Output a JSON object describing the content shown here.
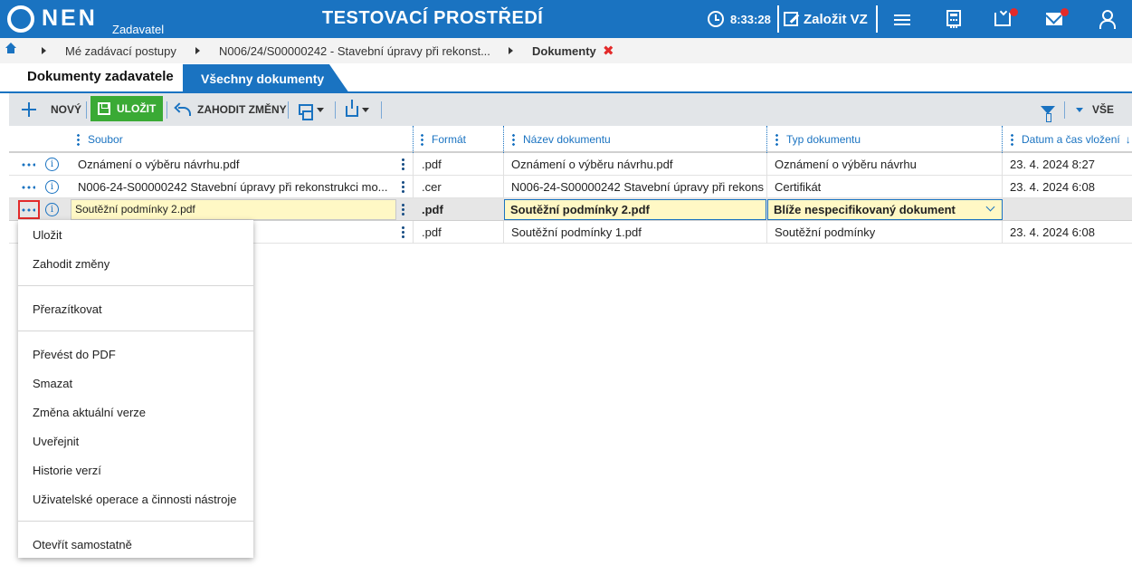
{
  "topbar": {
    "logo": "NEN",
    "logo_sub": "Zadavatel",
    "env_title": "TESTOVACÍ PROSTŘEDÍ",
    "time": "8:33:28",
    "create_label": "Založit VZ",
    "icons": [
      "clock-icon",
      "edit-icon",
      "menu-icon",
      "calculator-icon",
      "inbox-icon",
      "mail-icon",
      "user-icon"
    ]
  },
  "breadcrumb": {
    "items": [
      "Mé zadávací postupy",
      "N006/24/S00000242 - Stavební úpravy při rekonst...",
      "Dokumenty"
    ],
    "close": "✖"
  },
  "tabs": {
    "active": "Dokumenty zadavatele",
    "other": "Všechny dokumenty"
  },
  "toolbar": {
    "new_label": "NOVÝ",
    "save_label": "ULOŽIT",
    "discard_label": "ZAHODIT ZMĚNY",
    "filter_label": "VŠE"
  },
  "grid": {
    "columns": [
      "Soubor",
      "Formát",
      "Název dokumentu",
      "Typ dokumentu",
      "Datum a čas vložení"
    ],
    "sort_icon": "↓",
    "rows": [
      {
        "file": "Oznámení o výběru návrhu.pdf",
        "format": ".pdf",
        "name": "Oznámení o výběru návrhu.pdf",
        "type": "Oznámení o výběru návrhu",
        "date": "23. 4. 2024 8:27"
      },
      {
        "file": "N006-24-S00000242 Stavební úpravy při rekonstrukci mo...",
        "format": ".cer",
        "name": "N006-24-S00000242 Stavební úpravy při rekons...",
        "type": "Certifikát",
        "date": "23. 4. 2024 6:08"
      },
      {
        "file": "Soutěžní podmínky 2.pdf",
        "format": ".pdf",
        "name": "Soutěžní podmínky 2.pdf",
        "type": "Blíže nespecifikovaný dokument",
        "date": ""
      },
      {
        "file": "",
        "format": ".pdf",
        "name": "Soutěžní podmínky 1.pdf",
        "type": "Soutěžní podmínky",
        "date": "23. 4. 2024 6:08"
      }
    ],
    "info_glyph": "i"
  },
  "context_menu": {
    "items": [
      "Uložit",
      "Zahodit změny",
      "Přerazítkovat",
      "Převést do PDF",
      "Smazat",
      "Změna aktuální verze",
      "Uveřejnit",
      "Historie verzí",
      "Uživatelské operace a činnosti nástroje",
      "Otevřít samostatně"
    ]
  },
  "colors": {
    "brand": "#1a73c1",
    "save": "#3aaa35",
    "edit_bg": "#fff8c5",
    "alert": "#e32a2a"
  }
}
